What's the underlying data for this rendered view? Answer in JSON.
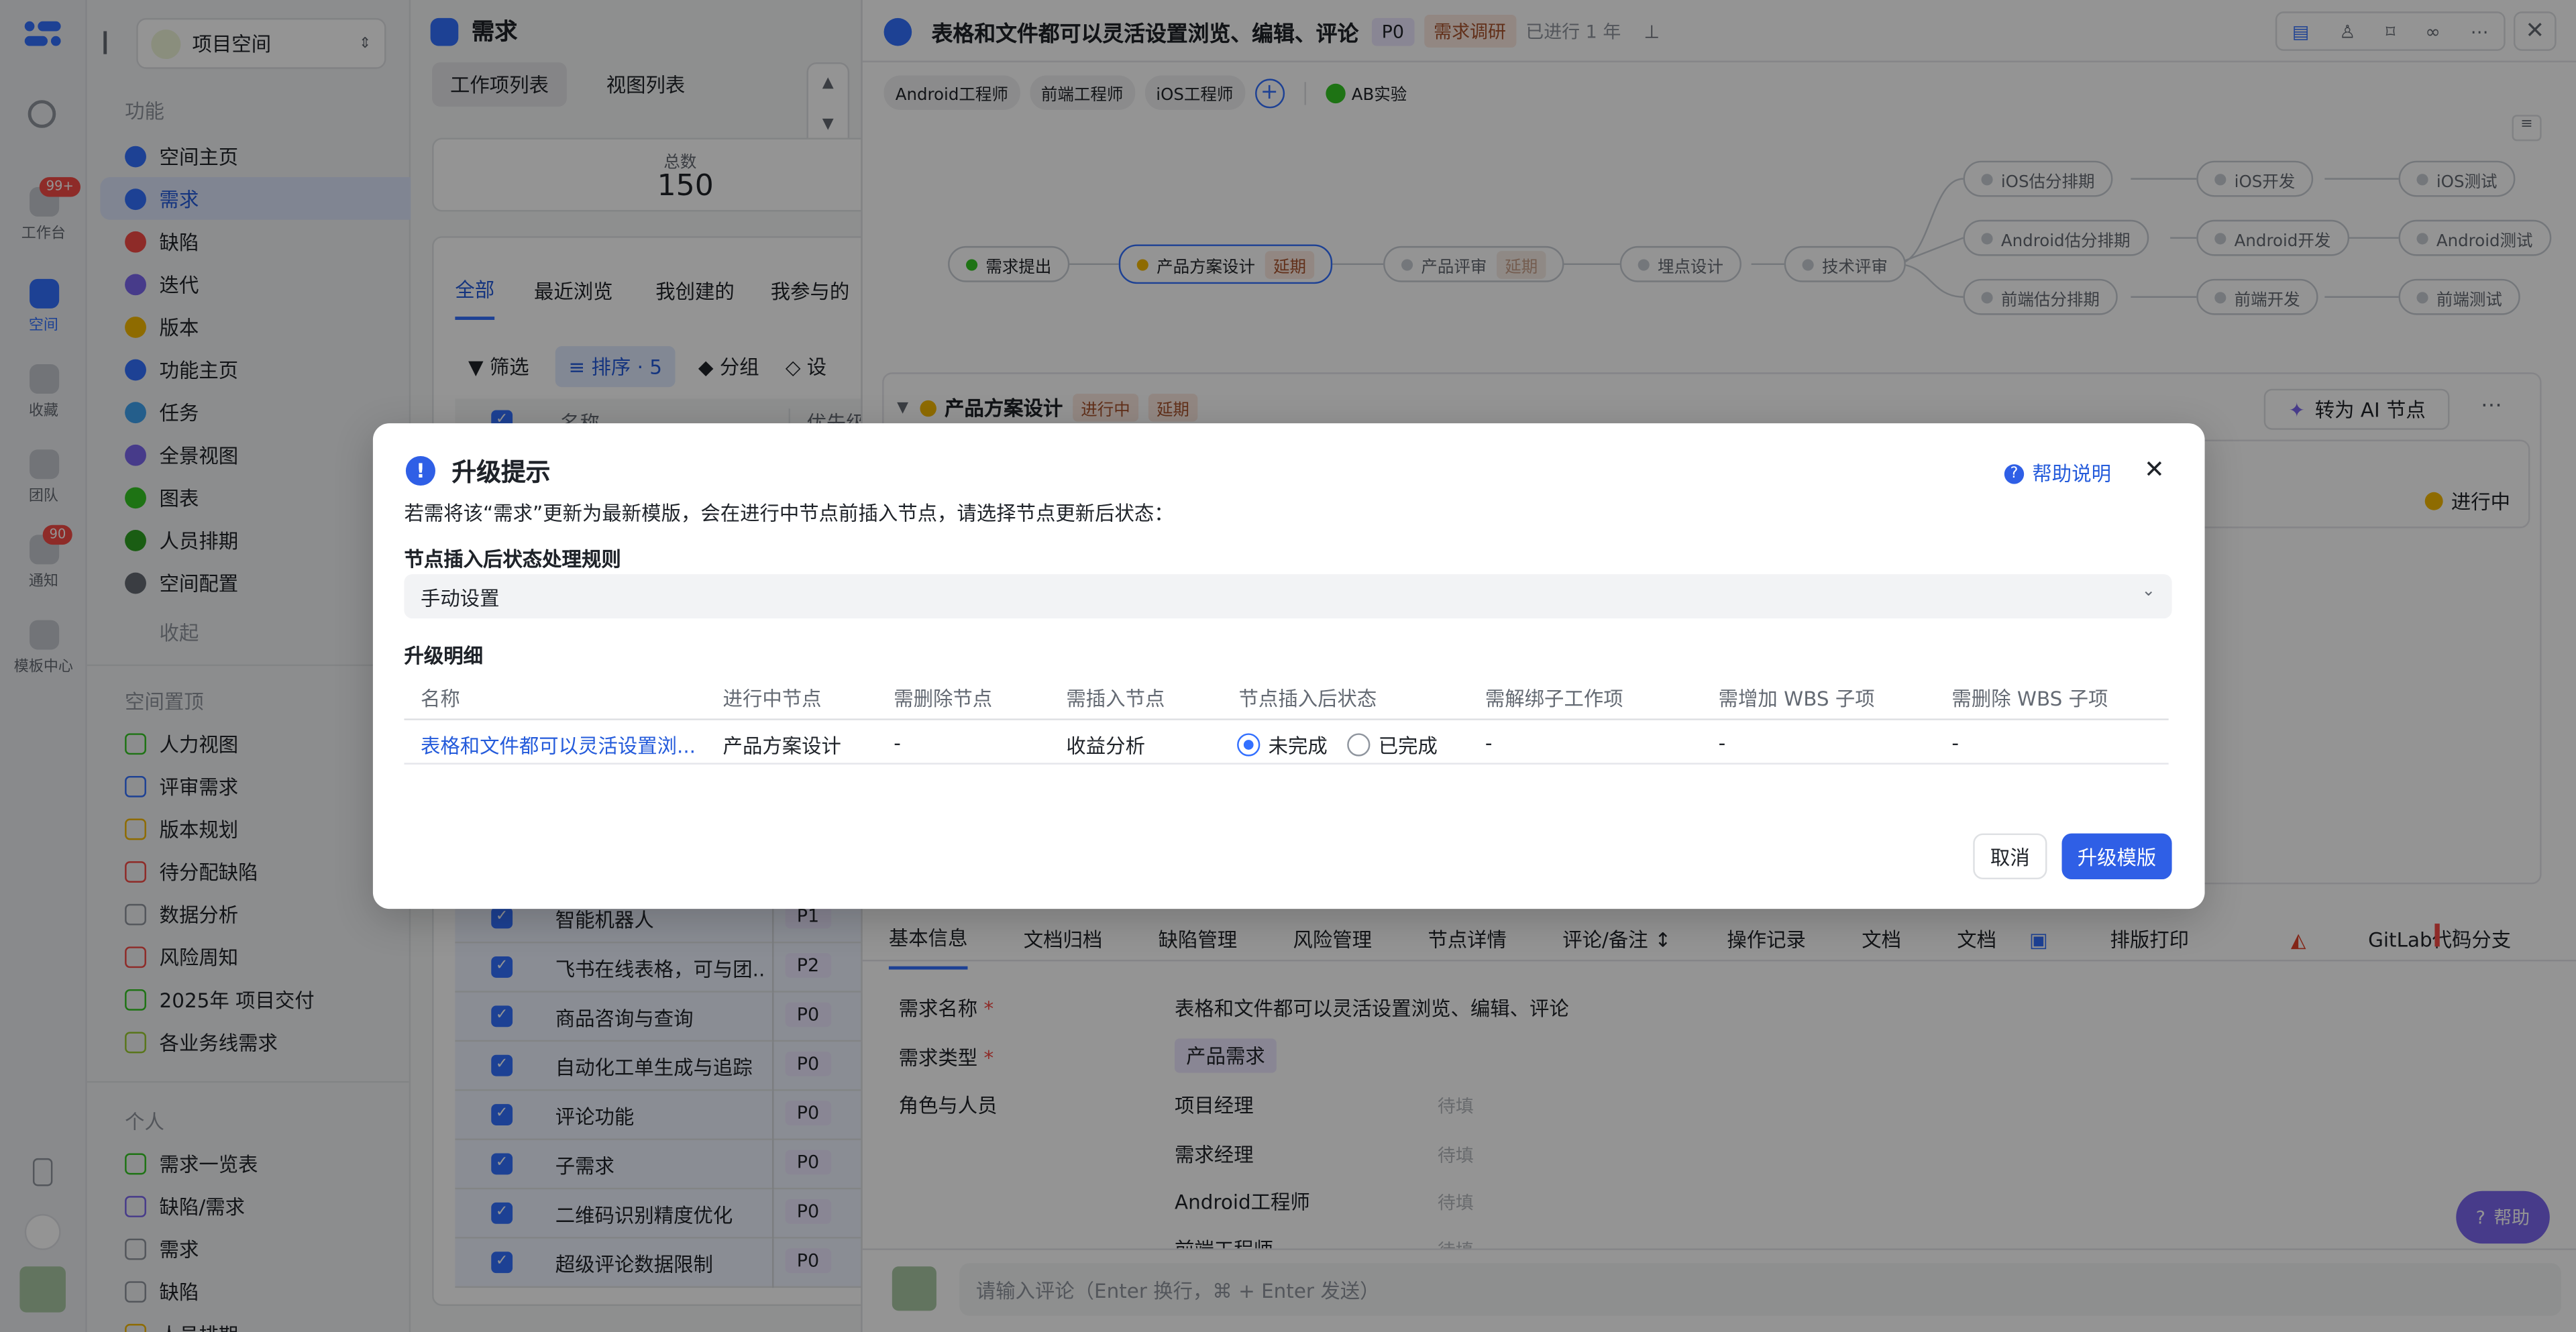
{
  "rail": {
    "items": [
      {
        "label": "工作台",
        "badge": "99+"
      },
      {
        "label": "空间"
      },
      {
        "label": "收藏"
      },
      {
        "label": "团队"
      },
      {
        "label": "通知",
        "badge": "90"
      },
      {
        "label": "模板中心"
      }
    ]
  },
  "sidebar": {
    "space_selector": "项目空间",
    "features_title": "功能",
    "features": [
      "空间主页",
      "需求",
      "缺陷",
      "迭代",
      "版本",
      "功能主页",
      "任务",
      "全景视图",
      "图表",
      "人员排期",
      "空间配置"
    ],
    "collapse": "收起",
    "pinned_title": "空间置顶",
    "pinned": [
      "人力视图",
      "评审需求",
      "版本规划",
      "待分配缺陷",
      "数据分析",
      "风险周知",
      "2025年 项目交付",
      "各业务线需求"
    ],
    "personal_title": "个人",
    "personal": [
      "需求一览表",
      "缺陷/需求",
      "需求",
      "缺陷",
      "人员排期"
    ]
  },
  "list": {
    "title": "需求",
    "view_tabs": [
      "工作项列表",
      "视图列表"
    ],
    "total_label": "总数",
    "total_value": "150",
    "filter_tabs": [
      "全部",
      "最近浏览",
      "我创建的",
      "我参与的"
    ],
    "toolbar": {
      "filter": "筛选",
      "sort": "排序 · 5",
      "group": "分组",
      "settings": "设"
    },
    "columns": [
      "名称",
      "优先级"
    ],
    "rows": [
      {
        "name": "智能机器人",
        "priority": "P1"
      },
      {
        "name": "飞书在线表格，可与团...",
        "priority": "P2"
      },
      {
        "name": "商品咨询与查询",
        "priority": "P0"
      },
      {
        "name": "自动化工单生成与追踪",
        "priority": "P0"
      },
      {
        "name": "评论功能",
        "priority": "P0"
      },
      {
        "name": "子需求",
        "priority": "P0"
      },
      {
        "name": "二维码识别精度优化",
        "priority": "P0"
      },
      {
        "name": "超级评论数据限制",
        "priority": "P0"
      }
    ]
  },
  "detail": {
    "title": "表格和文件都可以灵活设置浏览、编辑、评论",
    "priority": "P0",
    "stage": "需求调研",
    "elapsed": "已进行 1 年",
    "roles": [
      "Android工程师",
      "前端工程师",
      "iOS工程师"
    ],
    "ab_label": "AB实验",
    "flow_nodes": {
      "n1": "需求提出",
      "n2": "产品方案设计",
      "n2_tag": "延期",
      "n3": "产品评审",
      "n3_tag": "延期",
      "n4": "埋点设计",
      "n5": "技术评审",
      "b1": "iOS估分排期",
      "b2": "Android估分排期",
      "b3": "前端估分排期",
      "c1": "iOS开发",
      "c2": "Android开发",
      "c3": "前端开发",
      "d1": "iOS测试",
      "d2": "Android测试",
      "d3": "前端测试"
    },
    "node_panel": {
      "name": "产品方案设计",
      "status": "进行中",
      "tag": "延期",
      "ai_button": "转为 AI 节点",
      "progress_status": "进行中"
    },
    "tabs": [
      "基本信息",
      "文档归档",
      "缺陷管理",
      "风险管理",
      "节点详情",
      "评论/备注",
      "操作记录",
      "文档",
      "文档",
      "排版打印",
      "GitLab代码分支"
    ],
    "fields": {
      "name_label": "需求名称",
      "name_value": "表格和文件都可以灵活设置浏览、编辑、评论",
      "type_label": "需求类型",
      "type_value": "产品需求",
      "roles_label": "角色与人员",
      "role_rows": [
        {
          "role": "项目经理",
          "value": "待填"
        },
        {
          "role": "需求经理",
          "value": "待填"
        },
        {
          "role": "Android工程师",
          "value": "待填"
        },
        {
          "role": "前端工程师",
          "value": "待填"
        }
      ]
    },
    "comment_placeholder": "请输入评论（Enter 换行，⌘ + Enter 发送）",
    "help": "帮助"
  },
  "modal": {
    "title": "升级提示",
    "help_link": "帮助说明",
    "description": "若需将该“需求”更新为最新模版，会在进行中节点前插入节点，请选择节点更新后状态：",
    "rule_label": "节点插入后状态处理规则",
    "rule_value": "手动设置",
    "detail_label": "升级明细",
    "columns": [
      "名称",
      "进行中节点",
      "需删除节点",
      "需插入节点",
      "节点插入后状态",
      "需解绑子工作项",
      "需增加 WBS 子项",
      "需删除 WBS 子项"
    ],
    "row": {
      "name": "表格和文件都可以灵活设置浏...",
      "current_node": "产品方案设计",
      "delete_node": "-",
      "insert_node": "收益分析",
      "status_options": [
        "未完成",
        "已完成"
      ],
      "selected_status": "未完成",
      "unbind": "-",
      "wbs_add": "-",
      "wbs_delete": "-"
    },
    "cancel": "取消",
    "confirm": "升级模版"
  },
  "colors": {
    "primary": "#3370ff",
    "confirm": "#2f5fe6",
    "delay": "#a8522b",
    "danger": "#f54a45"
  }
}
